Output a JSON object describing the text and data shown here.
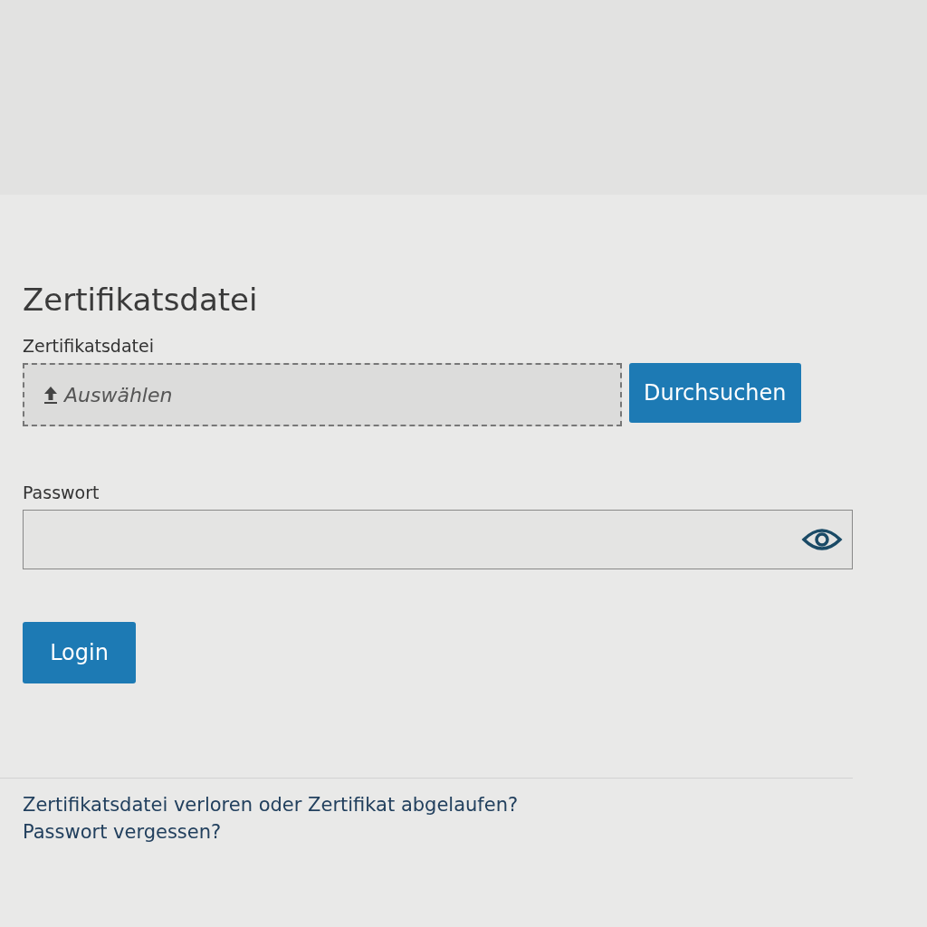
{
  "heading": "Zertifikatsdatei",
  "file_field": {
    "label": "Zertifikatsdatei",
    "placeholder": "Auswählen",
    "button": "Durchsuchen"
  },
  "password_field": {
    "label": "Passwort"
  },
  "login_button": "Login",
  "links": [
    "Zertifikatsdatei verloren oder Zertifikat abgelaufen?",
    "Passwort vergessen?"
  ]
}
